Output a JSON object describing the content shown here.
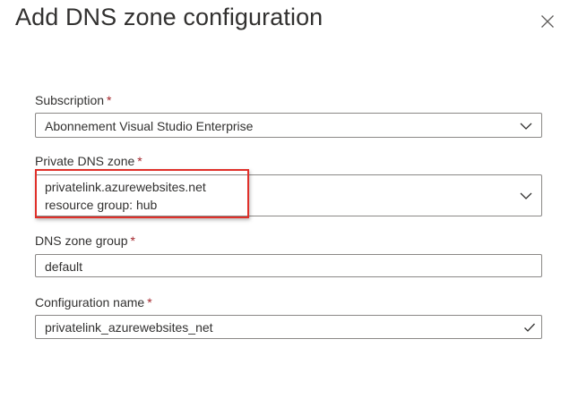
{
  "dialog": {
    "title": "Add DNS zone configuration",
    "close_icon": "close-icon"
  },
  "fields": {
    "subscription": {
      "label": "Subscription",
      "required_marker": "*",
      "value": "Abonnement Visual Studio Enterprise",
      "icon": "chevron-down-icon"
    },
    "private_dns_zone": {
      "label": "Private DNS zone",
      "required_marker": "*",
      "value_line1": "privatelink.azurewebsites.net",
      "value_line2": "resource group: hub",
      "icon": "chevron-down-icon"
    },
    "dns_zone_group": {
      "label": "DNS zone group",
      "required_marker": "*",
      "value": "default"
    },
    "configuration_name": {
      "label": "Configuration name",
      "required_marker": "*",
      "value": "privatelink_azurewebsites_net",
      "icon": "checkmark-icon"
    }
  },
  "colors": {
    "required": "#a4262c",
    "highlight_border": "#e0302a",
    "input_border": "#8a8886",
    "text": "#323130"
  }
}
